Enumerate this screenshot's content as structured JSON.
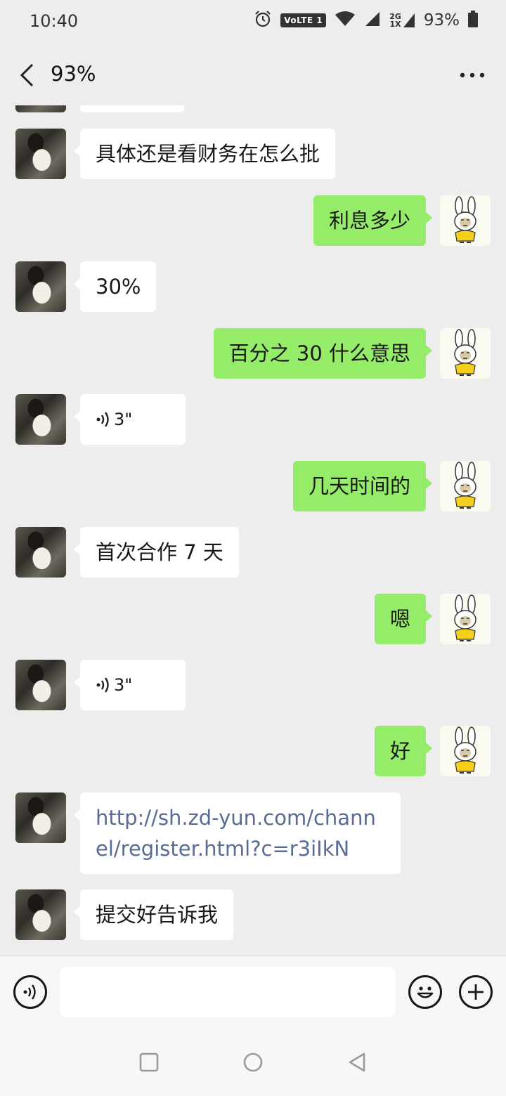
{
  "status_bar": {
    "time": "10:40",
    "volte_label": "VoLTE 1",
    "network_2g": "2G",
    "network_1x": "1X",
    "battery_text": "93%"
  },
  "header": {
    "title": "93%"
  },
  "messages": [
    {
      "side": "in",
      "type": "text",
      "text": "具体还是看财务在怎么批"
    },
    {
      "side": "out",
      "type": "text",
      "text": "利息多少"
    },
    {
      "side": "in",
      "type": "text",
      "text": "30%"
    },
    {
      "side": "out",
      "type": "text",
      "text": "百分之 30 什么意思"
    },
    {
      "side": "in",
      "type": "voice",
      "duration": "3\""
    },
    {
      "side": "out",
      "type": "text",
      "text": "几天时间的"
    },
    {
      "side": "in",
      "type": "text",
      "text": "首次合作 7 天"
    },
    {
      "side": "out",
      "type": "text",
      "text": "嗯"
    },
    {
      "side": "in",
      "type": "voice",
      "duration": "3\""
    },
    {
      "side": "out",
      "type": "text",
      "text": "好"
    },
    {
      "side": "in",
      "type": "link",
      "text": "http://sh.zd-yun.com/channel/register.html?c=r3iIkN"
    },
    {
      "side": "in",
      "type": "text",
      "text": "提交好告诉我"
    }
  ],
  "input_bar": {
    "voice_icon": "voice-mode-icon",
    "emoji_icon": "emoji-icon",
    "plus_icon": "plus-icon",
    "input_value": ""
  },
  "nav_bar": {
    "icons": [
      "recent-apps-icon",
      "home-icon",
      "back-icon"
    ]
  },
  "colors": {
    "background": "#ededed",
    "incoming_bubble": "#ffffff",
    "outgoing_bubble": "#95ec69",
    "link": "#576b95"
  }
}
